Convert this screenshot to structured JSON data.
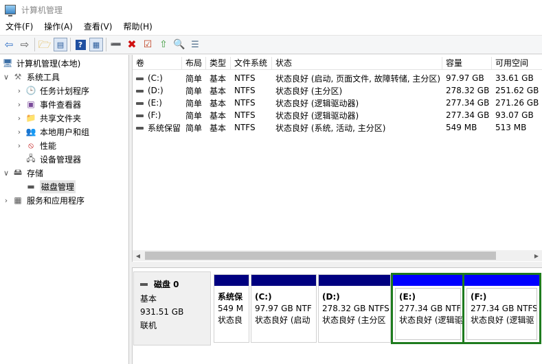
{
  "window": {
    "title": "计算机管理"
  },
  "menu": [
    "文件(F)",
    "操作(A)",
    "查看(V)",
    "帮助(H)"
  ],
  "tree": {
    "root": "计算机管理(本地)",
    "system_tools": "系统工具",
    "task_scheduler": "任务计划程序",
    "event_viewer": "事件查看器",
    "shared_folders": "共享文件夹",
    "local_users": "本地用户和组",
    "performance": "性能",
    "device_manager": "设备管理器",
    "storage": "存储",
    "disk_management": "磁盘管理",
    "services_apps": "服务和应用程序"
  },
  "columns": [
    "卷",
    "布局",
    "类型",
    "文件系统",
    "状态",
    "容量",
    "可用空间"
  ],
  "volumes": [
    {
      "vol": "(C:)",
      "layout": "简单",
      "type": "基本",
      "fs": "NTFS",
      "status": "状态良好 (启动, 页面文件, 故障转储, 主分区)",
      "capacity": "97.97 GB",
      "free": "33.61 GB"
    },
    {
      "vol": "(D:)",
      "layout": "简单",
      "type": "基本",
      "fs": "NTFS",
      "status": "状态良好 (主分区)",
      "capacity": "278.32 GB",
      "free": "251.62 GB"
    },
    {
      "vol": "(E:)",
      "layout": "简单",
      "type": "基本",
      "fs": "NTFS",
      "status": "状态良好 (逻辑驱动器)",
      "capacity": "277.34 GB",
      "free": "271.26 GB"
    },
    {
      "vol": "(F:)",
      "layout": "简单",
      "type": "基本",
      "fs": "NTFS",
      "status": "状态良好 (逻辑驱动器)",
      "capacity": "277.34 GB",
      "free": "93.07 GB"
    },
    {
      "vol": "系统保留",
      "layout": "简单",
      "type": "基本",
      "fs": "NTFS",
      "status": "状态良好 (系统, 活动, 主分区)",
      "capacity": "549 MB",
      "free": "513 MB"
    }
  ],
  "disk": {
    "name": "磁盘 0",
    "type": "基本",
    "size": "931.51 GB",
    "state": "联机"
  },
  "partitions": [
    {
      "name": "系统保",
      "size": "549 M",
      "status": "状态良"
    },
    {
      "name": "(C:)",
      "size": "97.97 GB NTF",
      "status": "状态良好 (启动"
    },
    {
      "name": "(D:)",
      "size": "278.32 GB NTFS",
      "status": "状态良好 (主分区"
    },
    {
      "name": "(E:)",
      "size": "277.34 GB NTF",
      "status": "状态良好 (逻辑驱"
    },
    {
      "name": "(F:)",
      "size": "277.34 GB NTFS",
      "status": "状态良好 (逻辑驱"
    }
  ],
  "colors": {
    "primary_bar": "#000080",
    "logical_bar": "#0000ff",
    "selection": "#1e7b1e"
  }
}
